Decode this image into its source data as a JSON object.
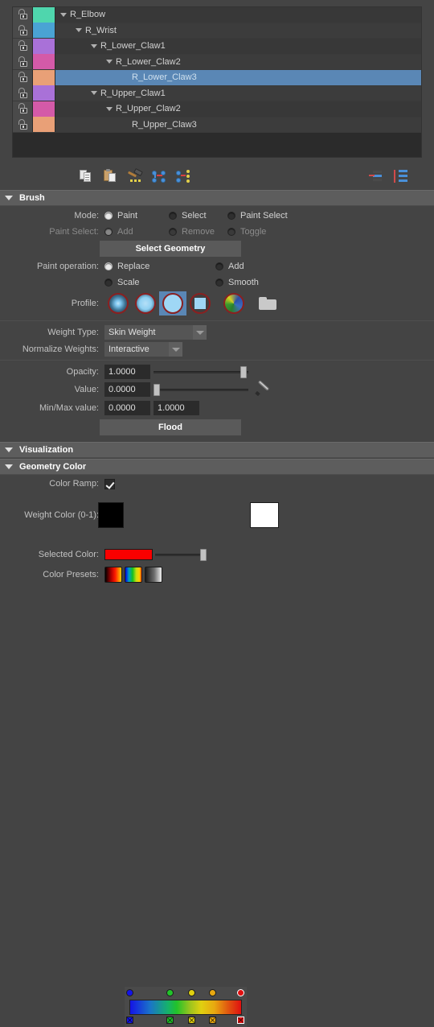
{
  "tree": {
    "rows": [
      {
        "label": "R_Elbow",
        "color": "#4fd6ad",
        "indent": 0,
        "has_arrow": true,
        "selected": false
      },
      {
        "label": "R_Wrist",
        "color": "#4aa3d4",
        "indent": 1,
        "has_arrow": true,
        "selected": false
      },
      {
        "label": "R_Lower_Claw1",
        "color": "#a971d8",
        "indent": 2,
        "has_arrow": true,
        "selected": false
      },
      {
        "label": "R_Lower_Claw2",
        "color": "#d45aa8",
        "indent": 3,
        "has_arrow": true,
        "selected": false
      },
      {
        "label": "R_Lower_Claw3",
        "color": "#e9a077",
        "indent": 4,
        "has_arrow": false,
        "selected": true
      },
      {
        "label": "R_Upper_Claw1",
        "color": "#a971d8",
        "indent": 2,
        "has_arrow": true,
        "selected": false
      },
      {
        "label": "R_Upper_Claw2",
        "color": "#d45aa8",
        "indent": 3,
        "has_arrow": true,
        "selected": false
      },
      {
        "label": "R_Upper_Claw3",
        "color": "#e9a077",
        "indent": 4,
        "has_arrow": false,
        "selected": false
      }
    ],
    "lock_icon": "unlocked-padlock-icon"
  },
  "tree_toolbar": {
    "buttons": [
      {
        "name": "copy-weights-icon",
        "tooltip": "Copy Weights"
      },
      {
        "name": "paste-weights-icon",
        "tooltip": "Paste Weights"
      },
      {
        "name": "hammer-weights-icon",
        "tooltip": "Hammer Skin Weights"
      },
      {
        "name": "move-weights-icon",
        "tooltip": "Move Weights"
      },
      {
        "name": "show-influenced-icon",
        "tooltip": "Show Influenced"
      }
    ],
    "right_buttons": [
      {
        "name": "move-to-list-icon",
        "tooltip": "Move Influence"
      },
      {
        "name": "sort-list-icon",
        "tooltip": "Sort List"
      }
    ]
  },
  "brush": {
    "section_title": "Brush",
    "mode": {
      "label": "Mode:",
      "options": [
        "Paint",
        "Select",
        "Paint Select"
      ],
      "selected": "Paint"
    },
    "paint_select": {
      "label": "Paint Select:",
      "options": [
        "Add",
        "Remove",
        "Toggle"
      ],
      "selected": "Add",
      "disabled": true
    },
    "select_geometry_button": "Select Geometry",
    "paint_operation": {
      "label": "Paint operation:",
      "options": [
        "Replace",
        "Add",
        "Scale",
        "Smooth"
      ],
      "selected": "Replace"
    },
    "profile": {
      "label": "Profile:",
      "items": [
        {
          "name": "gaussian-brush-icon",
          "selected": false
        },
        {
          "name": "soft-brush-icon",
          "selected": false
        },
        {
          "name": "solid-brush-icon",
          "selected": true
        },
        {
          "name": "square-brush-icon",
          "selected": false
        },
        {
          "name": "custom-brush-icon",
          "selected": false
        }
      ],
      "browse": "folder-icon"
    },
    "weight_type": {
      "label": "Weight Type:",
      "value": "Skin Weight"
    },
    "normalize_weights": {
      "label": "Normalize Weights:",
      "value": "Interactive"
    },
    "opacity": {
      "label": "Opacity:",
      "value": "1.0000",
      "slider_pct": 100
    },
    "value": {
      "label": "Value:",
      "value": "0.0000",
      "slider_pct": 0,
      "eyedropper": "eyedropper-icon"
    },
    "min_max": {
      "label": "Min/Max value:",
      "min": "0.0000",
      "max": "1.0000"
    },
    "flood_button": "Flood"
  },
  "visualization": {
    "section_title": "Visualization"
  },
  "geometry_color": {
    "section_title": "Geometry Color",
    "color_ramp": {
      "label": "Color Ramp:",
      "checked": true
    },
    "weight_color": {
      "label": "Weight Color (0-1):",
      "left_swatch": "#000000",
      "right_swatch": "#ffffff",
      "stops": [
        {
          "pos": 0,
          "color": "#1414e6",
          "selected": false
        },
        {
          "pos": 36,
          "color": "#22c22a",
          "selected": false
        },
        {
          "pos": 55,
          "color": "#e0d010",
          "selected": false
        },
        {
          "pos": 74,
          "color": "#e8a810",
          "selected": false
        },
        {
          "pos": 99,
          "color": "#e01010",
          "selected": true
        }
      ]
    },
    "selected_color": {
      "label": "Selected Color:",
      "swatch": "#fa0000",
      "slider_pct": 100
    },
    "color_presets": {
      "label": "Color Presets:",
      "items": [
        {
          "name": "preset-black-red-yellow",
          "gradient": "linear-gradient(90deg,#000000 0%,#b40000 38%,#ff1a00 62%,#ffd000 100%)"
        },
        {
          "name": "preset-rainbow",
          "gradient": "linear-gradient(90deg,#0000e0 0%,#00a0c8 22%,#12c020 45%,#c8e010 68%,#ffd000 88%,#ff4000 100%)"
        },
        {
          "name": "preset-grayscale",
          "gradient": "linear-gradient(90deg,#1a1a1a 0%,#6e6e6e 55%,#f0f0f0 100%)"
        }
      ]
    }
  },
  "colors": {
    "window_bg": "#444444",
    "panel_bg": "#2b2b2b",
    "section_header": "#5d5d5d",
    "selection_blue": "#5a87b5",
    "field_bg": "#2b2b2b"
  }
}
